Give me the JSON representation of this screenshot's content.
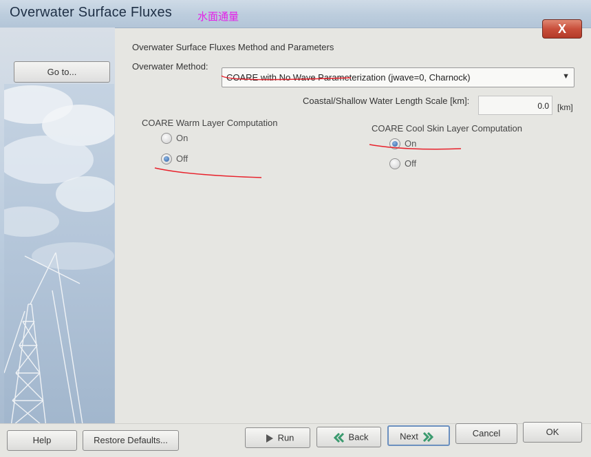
{
  "window": {
    "title": "Overwater Surface Fluxes",
    "annotation": "水面通量",
    "close_label": "X"
  },
  "sidebar": {
    "goto_label": "Go to..."
  },
  "main": {
    "section_title": "Overwater Surface Fluxes Method and Parameters",
    "method_label": "Overwater Method:",
    "method_value": "COARE with No Wave Parameterization (jwave=0, Charnock)",
    "coastal_label": "Coastal/Shallow Water Length Scale [km]:",
    "coastal_value": "0.0",
    "coastal_unit": "[km]",
    "warm_layer": {
      "label": "COARE Warm Layer Computation",
      "options": [
        {
          "label": "On",
          "selected": false
        },
        {
          "label": "Off",
          "selected": true
        }
      ]
    },
    "cool_skin": {
      "label": "COARE Cool Skin Layer Computation",
      "options": [
        {
          "label": "On",
          "selected": true
        },
        {
          "label": "Off",
          "selected": false
        }
      ]
    }
  },
  "footer": {
    "help": "Help",
    "restore": "Restore Defaults...",
    "run": "Run",
    "back": "Back",
    "next": "Next",
    "cancel": "Cancel",
    "ok": "OK"
  },
  "colors": {
    "annotation": "#e51ee8",
    "red_marks": "#e8202a",
    "arrow_green": "#3a9a6e"
  }
}
